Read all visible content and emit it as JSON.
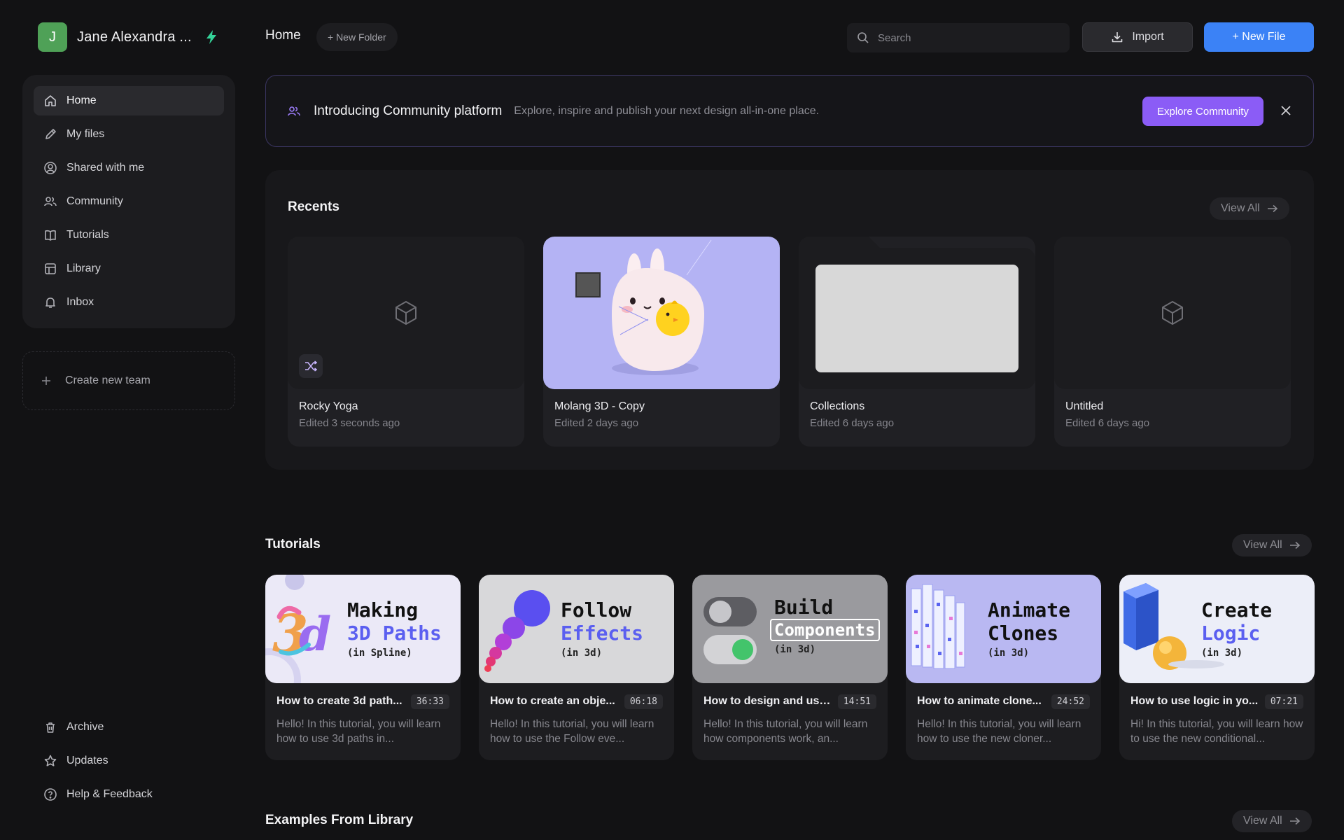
{
  "user": {
    "initial": "J",
    "name": "Jane Alexandra ..."
  },
  "sidebar": {
    "items": [
      {
        "label": "Home",
        "icon": "home-icon",
        "active": true
      },
      {
        "label": "My files",
        "icon": "pencil-icon"
      },
      {
        "label": "Shared with me",
        "icon": "user-circle-icon"
      },
      {
        "label": "Community",
        "icon": "users-icon"
      },
      {
        "label": "Tutorials",
        "icon": "book-icon"
      },
      {
        "label": "Library",
        "icon": "layout-icon"
      },
      {
        "label": "Inbox",
        "icon": "bell-icon"
      }
    ],
    "create_team": "Create new team",
    "bottom": [
      {
        "label": "Archive",
        "icon": "trash-icon"
      },
      {
        "label": "Updates",
        "icon": "star-icon"
      },
      {
        "label": "Help & Feedback",
        "icon": "help-icon"
      }
    ]
  },
  "topbar": {
    "title": "Home",
    "new_folder": "+ New Folder",
    "search_placeholder": "Search",
    "import": "Import",
    "new_file": "+ New File"
  },
  "banner": {
    "title": "Introducing Community platform",
    "description": "Explore, inspire and publish your next design all-in-one place.",
    "button": "Explore Community"
  },
  "recents": {
    "title": "Recents",
    "view_all": "View All",
    "files": [
      {
        "name": "Rocky Yoga",
        "edited": "Edited 3 seconds ago"
      },
      {
        "name": "Molang 3D - Copy",
        "edited": "Edited 2 days ago"
      },
      {
        "name": "Collections",
        "edited": "Edited 6 days ago"
      },
      {
        "name": "Untitled",
        "edited": "Edited 6 days ago"
      }
    ]
  },
  "tutorials": {
    "title": "Tutorials",
    "view_all": "View All",
    "items": [
      {
        "thumb": [
          "Making",
          "3D Paths",
          "(in Spline)"
        ],
        "name": "How to create 3d path...",
        "duration": "36:33",
        "desc": "Hello! In this tutorial, you will learn how to use 3d paths in..."
      },
      {
        "thumb": [
          "Follow",
          "Effects",
          "(in 3d)"
        ],
        "name": "How to create an obje...",
        "duration": "06:18",
        "desc": "Hello! In this tutorial, you will learn how to use the Follow eve..."
      },
      {
        "thumb": [
          "Build",
          "Components",
          "(in 3d)"
        ],
        "name": "How to design and use...",
        "duration": "14:51",
        "desc": "Hello! In this tutorial, you will learn how components work, an..."
      },
      {
        "thumb": [
          "Animate",
          "Clones",
          "(in 3d)"
        ],
        "name": "How to animate clone...",
        "duration": "24:52",
        "desc": "Hello! In this tutorial, you will learn how to use the new cloner..."
      },
      {
        "thumb": [
          "Create",
          "Logic",
          "(in 3d)"
        ],
        "name": "How to use logic in yo...",
        "duration": "07:21",
        "desc": "Hi! In this tutorial, you will learn how to use the new conditional..."
      }
    ]
  },
  "examples": {
    "title": "Examples From Library",
    "view_all": "View All"
  },
  "colors": {
    "accent": "#3b82f6",
    "community": "#8b5cf6",
    "avatar": "#4fa157",
    "bolt": "#34d399"
  }
}
